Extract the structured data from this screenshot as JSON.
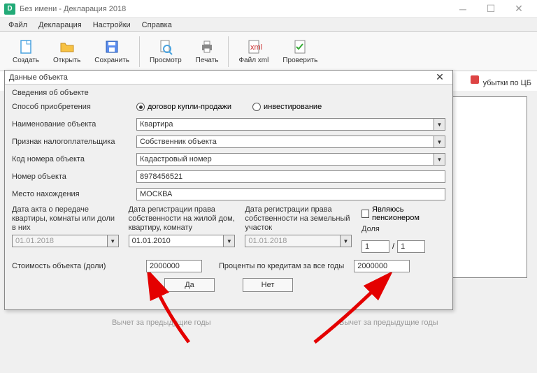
{
  "window": {
    "title": "Без имени - Декларация 2018",
    "logo": "D"
  },
  "menu": {
    "file": "Файл",
    "declaration": "Декларация",
    "settings": "Настройки",
    "help": "Справка"
  },
  "toolbar": {
    "create": "Создать",
    "open": "Открыть",
    "save": "Сохранить",
    "view": "Просмотр",
    "print": "Печать",
    "xml": "Файл xml",
    "check": "Проверить"
  },
  "toolbar2": {
    "tab_right": "убытки по ЦБ"
  },
  "dialog": {
    "title": "Данные объекта",
    "section": "Сведения об объекте",
    "labels": {
      "acquisition": "Способ приобретения",
      "name": "Наименование объекта",
      "taxpayer": "Признак налогоплательщика",
      "codenum": "Код номера объекта",
      "objnum": "Номер объекта",
      "location": "Место нахождения"
    },
    "radios": {
      "contract": "договор купли-продажи",
      "invest": "инвестирование"
    },
    "combos": {
      "name": "Квартира",
      "taxpayer": "Собственник объекта",
      "codenum": "Кадастровый номер"
    },
    "values": {
      "objnum": "8978456521",
      "location": "МОСКВА"
    },
    "dates": {
      "col1_label": "Дата акта о передаче квартиры, комнаты или доли в них",
      "col1_val": "01.01.2018",
      "col2_label": "Дата регистрации права собственности на жилой дом, квартиру, комнату",
      "col2_val": "01.01.2010",
      "col3_label": "Дата регистрации права собственности на земельный участок",
      "col3_val": "01.01.2018",
      "pensioner": "Являюсь пенсионером",
      "share_label": "Доля",
      "share_1": "1",
      "share_2": "1"
    },
    "cost": {
      "label": "Стоимость объекта (доли)",
      "value": "2000000",
      "percent_label": "Проценты по кредитам за все годы",
      "percent_value": "2000000"
    },
    "btns": {
      "yes": "Да",
      "no": "Нет"
    }
  },
  "bottom": {
    "label1": "Вычет за предыдущие годы",
    "label2": "Вычет за предыдущие годы"
  }
}
